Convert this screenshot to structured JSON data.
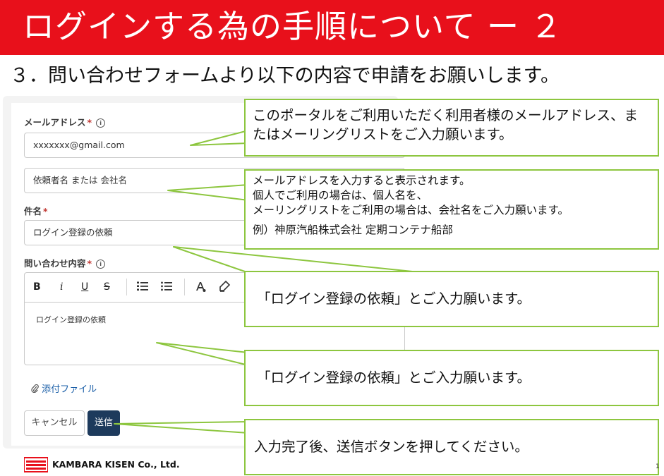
{
  "slide": {
    "title": "ログインする為の手順について ー ２",
    "subtitle": "３．問い合わせフォームより以下の内容で申請をお願いします。",
    "page_number": "1"
  },
  "form": {
    "email": {
      "label": "メールアドレス",
      "required_mark": "*",
      "info_icon": "i",
      "value": "xxxxxxx@gmail.com"
    },
    "requester": {
      "placeholder": "依頼者名 または 会社名"
    },
    "subject": {
      "label": "件名",
      "required_mark": "*",
      "value": "ログイン登録の依頼"
    },
    "inquiry": {
      "label": "問い合わせ内容",
      "required_mark": "*",
      "info_icon": "i",
      "toolbar": {
        "bold": "B",
        "italic": "i",
        "underline": "U",
        "strike": "S"
      },
      "value": "ログイン登録の依頼"
    },
    "attach_label": "添付ファイル",
    "cancel_label": "キャンセル",
    "submit_label": "送信"
  },
  "callouts": {
    "email_note": "このポータルをご利用いただく利用者様のメールアドレス、またはメーリングリストをご入力願います。",
    "requester_note_lines": [
      "メールアドレスを入力すると表示されます。",
      "個人でご利用の場合は、個人名を、",
      "メーリングリストをご利用の場合は、会社名をご入力願います。"
    ],
    "requester_example": "例）神原汽船株式会社 定期コンテナ船部",
    "subject_note": "「ログイン登録の依頼」とご入力願います。",
    "content_note": "「ログイン登録の依頼」とご入力願います。",
    "submit_note": "入力完了後、送信ボタンを押してください。"
  },
  "footer": {
    "company_name": "KAMBARA KISEN Co., Ltd."
  },
  "colors": {
    "header": "#e8101b",
    "callout_border": "#8dc63f",
    "submit_button": "#1d3a5c",
    "link": "#1b5fa8"
  }
}
